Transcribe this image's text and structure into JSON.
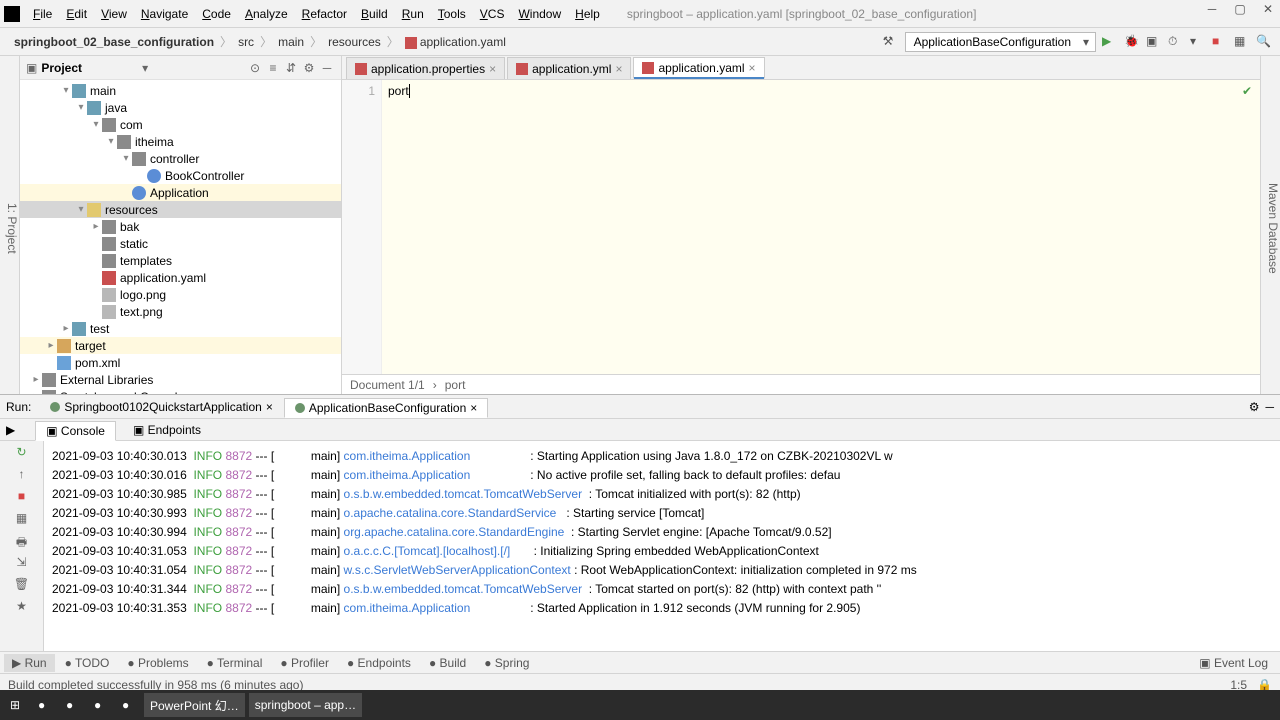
{
  "window": {
    "title": "springboot – application.yaml [springboot_02_base_configuration]"
  },
  "menu": [
    "File",
    "Edit",
    "View",
    "Navigate",
    "Code",
    "Analyze",
    "Refactor",
    "Build",
    "Run",
    "Tools",
    "VCS",
    "Window",
    "Help"
  ],
  "breadcrumbs": [
    "springboot_02_base_configuration",
    "src",
    "main",
    "resources",
    "application.yaml"
  ],
  "run_config": "ApplicationBaseConfiguration",
  "project": {
    "title": "Project",
    "tree": [
      {
        "indent": 2,
        "arrow": "▾",
        "icon": "folder-blue",
        "label": "main"
      },
      {
        "indent": 3,
        "arrow": "▾",
        "icon": "folder-blue",
        "label": "java"
      },
      {
        "indent": 4,
        "arrow": "▾",
        "icon": "folder",
        "label": "com"
      },
      {
        "indent": 5,
        "arrow": "▾",
        "icon": "folder",
        "label": "itheima"
      },
      {
        "indent": 6,
        "arrow": "▾",
        "icon": "folder",
        "label": "controller"
      },
      {
        "indent": 7,
        "arrow": "",
        "icon": "file-j",
        "label": "BookController"
      },
      {
        "indent": 6,
        "arrow": "",
        "icon": "file-j",
        "label": "Application",
        "highlight": true
      },
      {
        "indent": 3,
        "arrow": "▾",
        "icon": "folder-yellow",
        "label": "resources",
        "selected": true
      },
      {
        "indent": 4,
        "arrow": "▸",
        "icon": "folder",
        "label": "bak"
      },
      {
        "indent": 4,
        "arrow": "",
        "icon": "folder",
        "label": "static"
      },
      {
        "indent": 4,
        "arrow": "",
        "icon": "folder",
        "label": "templates"
      },
      {
        "indent": 4,
        "arrow": "",
        "icon": "file-y",
        "label": "application.yaml"
      },
      {
        "indent": 4,
        "arrow": "",
        "icon": "file-png",
        "label": "logo.png"
      },
      {
        "indent": 4,
        "arrow": "",
        "icon": "file-png",
        "label": "text.png"
      },
      {
        "indent": 2,
        "arrow": "▸",
        "icon": "folder-blue",
        "label": "test"
      },
      {
        "indent": 1,
        "arrow": "▸",
        "icon": "folder-orange",
        "label": "target",
        "highlight": true
      },
      {
        "indent": 1,
        "arrow": "",
        "icon": "file-x",
        "label": "pom.xml"
      },
      {
        "indent": 0,
        "arrow": "▸",
        "icon": "folder",
        "label": "External Libraries"
      },
      {
        "indent": 0,
        "arrow": "▸",
        "icon": "folder",
        "label": "Scratches and Consoles"
      }
    ]
  },
  "editor": {
    "tabs": [
      {
        "label": "application.properties",
        "active": false
      },
      {
        "label": "application.yml",
        "active": false
      },
      {
        "label": "application.yaml",
        "active": true
      }
    ],
    "line_number": "1",
    "content": "port",
    "breadcrumb": "Document 1/1",
    "breadcrumb2": "port"
  },
  "run": {
    "title": "Run:",
    "tabs": [
      {
        "label": "Springboot0102QuickstartApplication",
        "active": false
      },
      {
        "label": "ApplicationBaseConfiguration",
        "active": true
      }
    ],
    "subtabs": [
      {
        "label": "Console",
        "active": true
      },
      {
        "label": "Endpoints",
        "active": false
      }
    ],
    "log": [
      {
        "ts": "2021-09-03 10:40:30.013",
        "lvl": "INFO",
        "pid": "8872",
        "thread": "main",
        "cls": "com.itheima.Application",
        "msg": "Starting Application using Java 1.8.0_172 on CZBK-20210302VL w"
      },
      {
        "ts": "2021-09-03 10:40:30.016",
        "lvl": "INFO",
        "pid": "8872",
        "thread": "main",
        "cls": "com.itheima.Application",
        "msg": "No active profile set, falling back to default profiles: defau"
      },
      {
        "ts": "2021-09-03 10:40:30.985",
        "lvl": "INFO",
        "pid": "8872",
        "thread": "main",
        "cls": "o.s.b.w.embedded.tomcat.TomcatWebServer",
        "msg": "Tomcat initialized with port(s): 82 (http)"
      },
      {
        "ts": "2021-09-03 10:40:30.993",
        "lvl": "INFO",
        "pid": "8872",
        "thread": "main",
        "cls": "o.apache.catalina.core.StandardService",
        "msg": "Starting service [Tomcat]"
      },
      {
        "ts": "2021-09-03 10:40:30.994",
        "lvl": "INFO",
        "pid": "8872",
        "thread": "main",
        "cls": "org.apache.catalina.core.StandardEngine",
        "msg": "Starting Servlet engine: [Apache Tomcat/9.0.52]"
      },
      {
        "ts": "2021-09-03 10:40:31.053",
        "lvl": "INFO",
        "pid": "8872",
        "thread": "main",
        "cls": "o.a.c.c.C.[Tomcat].[localhost].[/]",
        "msg": "Initializing Spring embedded WebApplicationContext"
      },
      {
        "ts": "2021-09-03 10:40:31.054",
        "lvl": "INFO",
        "pid": "8872",
        "thread": "main",
        "cls": "w.s.c.ServletWebServerApplicationContext",
        "msg": "Root WebApplicationContext: initialization completed in 972 ms"
      },
      {
        "ts": "2021-09-03 10:40:31.344",
        "lvl": "INFO",
        "pid": "8872",
        "thread": "main",
        "cls": "o.s.b.w.embedded.tomcat.TomcatWebServer",
        "msg": "Tomcat started on port(s): 82 (http) with context path ''"
      },
      {
        "ts": "2021-09-03 10:40:31.353",
        "lvl": "INFO",
        "pid": "8872",
        "thread": "main",
        "cls": "com.itheima.Application",
        "msg": "Started Application in 1.912 seconds (JVM running for 2.905)"
      }
    ]
  },
  "bottom_tabs": [
    "Run",
    "TODO",
    "Problems",
    "Terminal",
    "Profiler",
    "Endpoints",
    "Build",
    "Spring"
  ],
  "event_log": "Event Log",
  "status": {
    "msg": "Build completed successfully in 958 ms (6 minutes ago)",
    "pos": "1:5"
  },
  "taskbar": [
    "⊞",
    "",
    "",
    "",
    "",
    "PowerPoint 幻…",
    "springboot – app…"
  ],
  "side_left": "1: Project",
  "side_right": "Maven   Database"
}
